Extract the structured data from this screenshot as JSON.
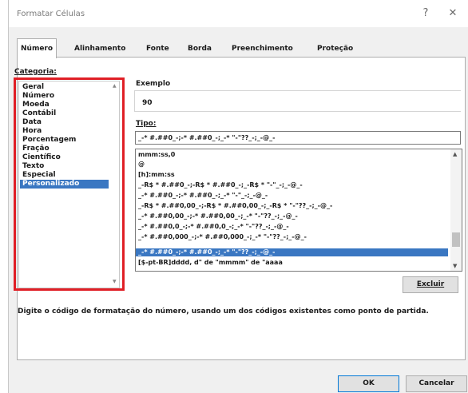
{
  "window": {
    "title": "Formatar Células",
    "help_label": "?",
    "close_label": "✕"
  },
  "tabs": [
    "Número",
    "Alinhamento",
    "Fonte",
    "Borda",
    "Preenchimento",
    "Proteção"
  ],
  "category": {
    "label": "Categoria:",
    "items": [
      "Geral",
      "Número",
      "Moeda",
      "Contábil",
      "Data",
      "Hora",
      "Porcentagem",
      "Fração",
      "Científico",
      "Texto",
      "Especial",
      "Personalizado"
    ],
    "selected": "Personalizado"
  },
  "example": {
    "label": "Exemplo",
    "value": "90"
  },
  "type": {
    "label": "Tipo:",
    "value": "_-* #.##0_-;-* #.##0_-;_-* \"-\"??_-;_-@_-"
  },
  "formats": [
    "mmm:ss,0",
    "@",
    "[h]:mm:ss",
    "_-R$ * #.##0_-;-R$ * #.##0_-;_-R$ * \"-\"_-;_-@_-",
    "_-* #.##0_-;-* #.##0_-;_-* \"-\"_-;_-@_-",
    "_-R$ * #.##0,00_-;-R$ * #.##0,00_-;_-R$ * \"-\"??_-;_-@_-",
    "_-* #.##0,00_-;-* #.##0,00_-;_-* \"-\"??_-;_-@_-",
    "_-* #.##0,0_-;-* #.##0,0_-;_-* \"-\"??_-;_-@_-",
    "_-* #.##0,000_-;-* #.##0,000_-;_-* \"-\"??_-;_-@_-",
    "_-* #.##0_-;-* #.##0_-;_-* \"-\"??_-;_-@_-",
    "[$-pt-BR]dddd, d\" de \"mmmm\" de \"aaaa"
  ],
  "selected_format_index": 9,
  "buttons": {
    "delete": "Excluir",
    "ok": "OK",
    "cancel": "Cancelar"
  },
  "description": "Digite o código de formatação do número, usando um dos códigos existentes como ponto de partida.",
  "colors": {
    "highlight": "#e01f26",
    "selection": "#3a77c2"
  },
  "icons": {
    "scroll_up": "chevron-up-icon",
    "scroll_down": "chevron-down-icon"
  }
}
